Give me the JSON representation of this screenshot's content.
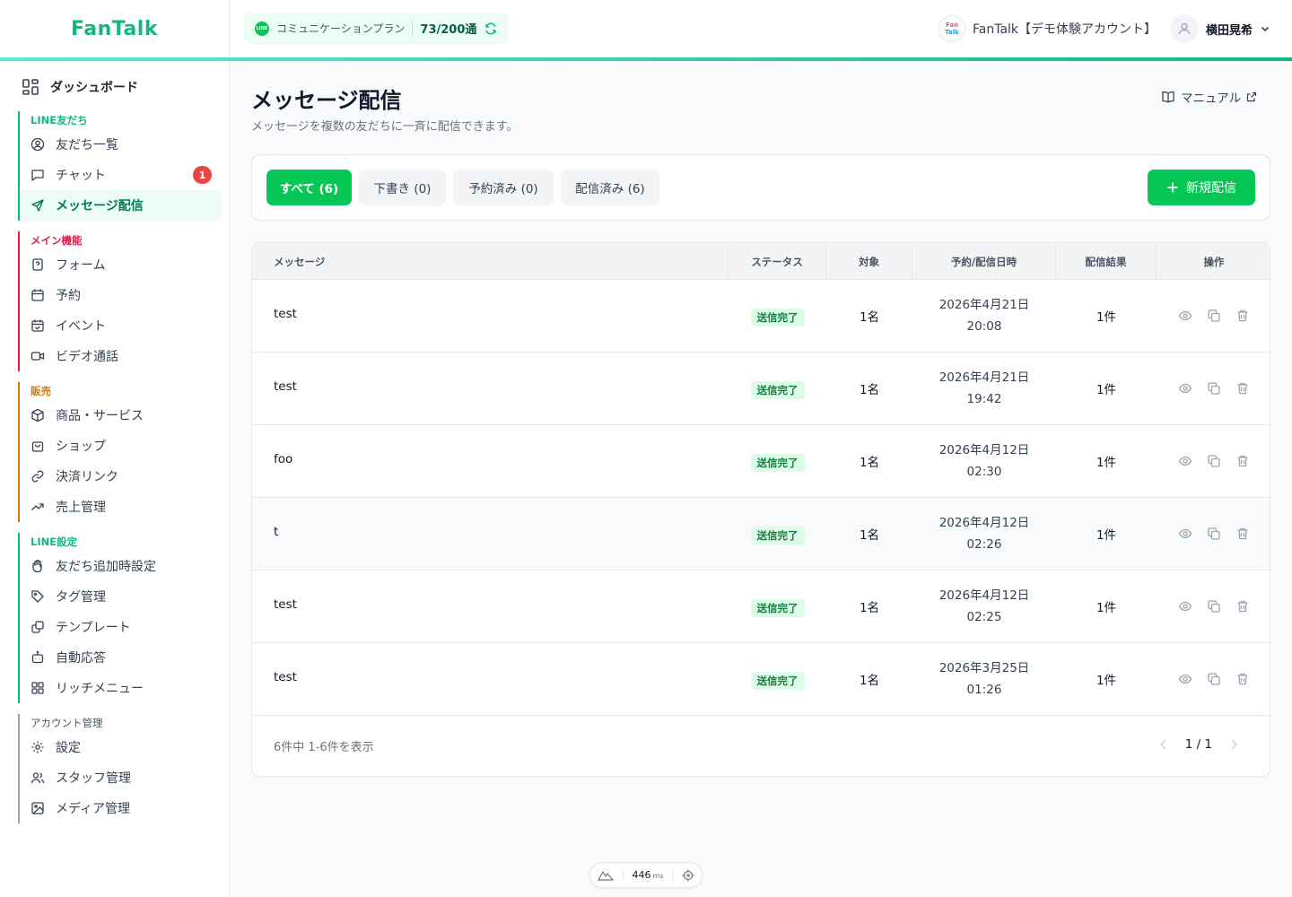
{
  "app": {
    "logo": "FanTalk",
    "plan_badge": "LINE",
    "plan_name": "コミュニケーションプラン",
    "plan_count": "73/200通",
    "account_logo_line1": "Fan",
    "account_logo_line2": "Talk",
    "account_name": "FanTalk【デモ体験アカウント】",
    "user_name": "横田晃希"
  },
  "sidebar": {
    "dashboard": "ダッシュボード",
    "groups": [
      {
        "title": "LINE友だち",
        "color": "#10b981",
        "items": [
          "友だち一覧",
          "チャット",
          "メッセージ配信"
        ]
      },
      {
        "title": "メイン機能",
        "color": "#e11d48",
        "items": [
          "フォーム",
          "予約",
          "イベント",
          "ビデオ通話"
        ]
      },
      {
        "title": "販売",
        "color": "#d97706",
        "items": [
          "商品・サービス",
          "ショップ",
          "決済リンク",
          "売上管理"
        ]
      },
      {
        "title": "LINE設定",
        "color": "#10b981",
        "items": [
          "友だち追加時設定",
          "タグ管理",
          "テンプレート",
          "自動応答",
          "リッチメニュー"
        ]
      },
      {
        "title": "アカウント管理",
        "color": "#6b7280",
        "items": [
          "設定",
          "スタッフ管理",
          "メディア管理"
        ]
      }
    ],
    "chat_badge": "1"
  },
  "page": {
    "title": "メッセージ配信",
    "subtitle": "メッセージを複数の友だちに一斉に配信できます。",
    "manual": "マニュアル"
  },
  "filters": {
    "tabs": [
      "すべて (6)",
      "下書き (0)",
      "予約済み (0)",
      "配信済み (6)"
    ],
    "new_button": "新規配信"
  },
  "table": {
    "headers": [
      "メッセージ",
      "ステータス",
      "対象",
      "予約/配信日時",
      "配信結果",
      "操作"
    ],
    "rows": [
      {
        "message": "test",
        "status": "送信完了",
        "target": "1名",
        "date": "2026年4月21日",
        "time": "20:08",
        "result": "1件"
      },
      {
        "message": "test",
        "status": "送信完了",
        "target": "1名",
        "date": "2026年4月21日",
        "time": "19:42",
        "result": "1件"
      },
      {
        "message": "foo",
        "status": "送信完了",
        "target": "1名",
        "date": "2026年4月12日",
        "time": "02:30",
        "result": "1件"
      },
      {
        "message": "t",
        "status": "送信完了",
        "target": "1名",
        "date": "2026年4月12日",
        "time": "02:26",
        "result": "1件"
      },
      {
        "message": "test",
        "status": "送信完了",
        "target": "1名",
        "date": "2026年4月12日",
        "time": "02:25",
        "result": "1件"
      },
      {
        "message": "test",
        "status": "送信完了",
        "target": "1名",
        "date": "2026年3月25日",
        "time": "01:26",
        "result": "1件"
      }
    ],
    "count_text": "6件中 1-6件を表示",
    "page_text": "1 / 1"
  },
  "perf": {
    "value": "446",
    "unit": "ms"
  }
}
